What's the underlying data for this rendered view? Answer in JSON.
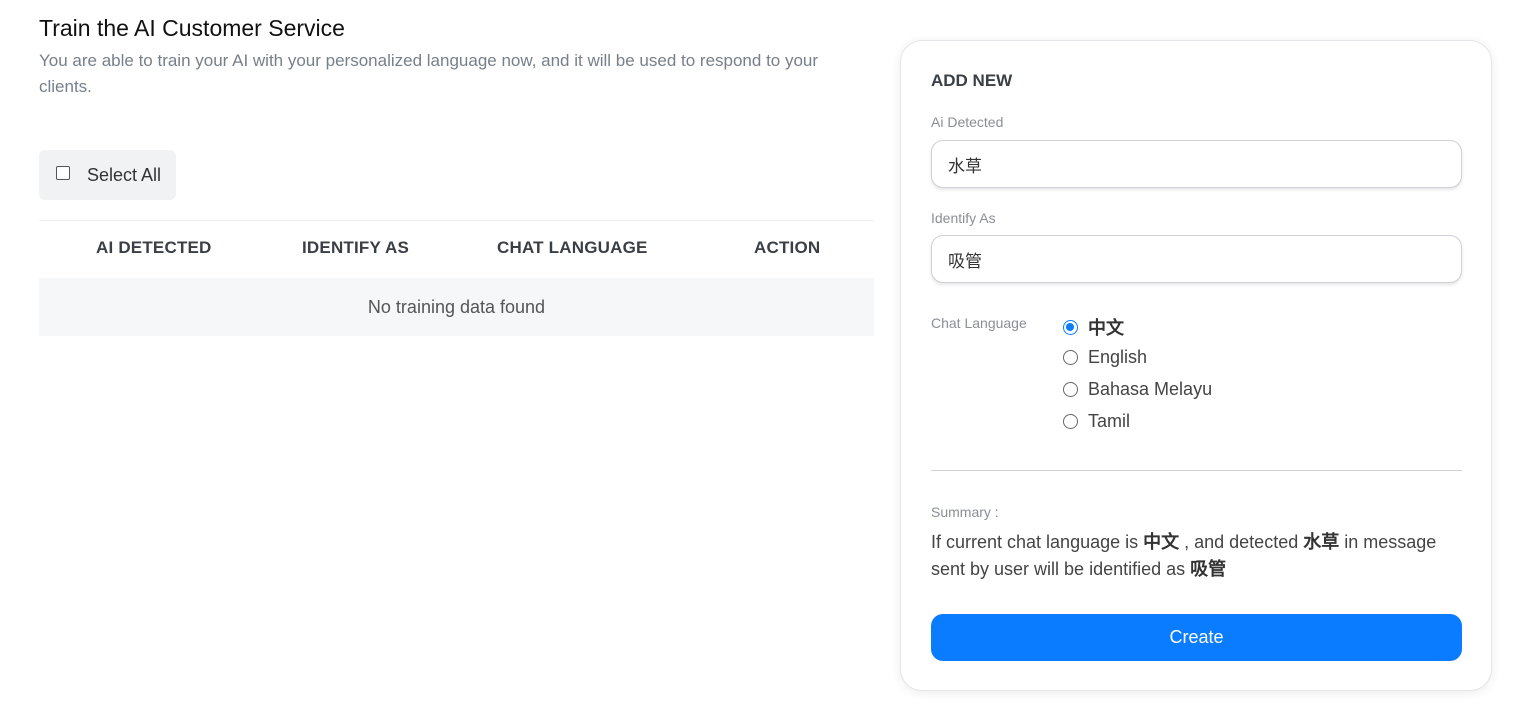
{
  "header": {
    "title": "Train the AI Customer Service",
    "subtitle": "You are able to train your AI with your personalized language now, and it will be used to respond to your clients."
  },
  "table": {
    "select_all_label": "Select All",
    "columns": [
      "AI DETECTED",
      "IDENTIFY AS",
      "CHAT LANGUAGE",
      "ACTION"
    ],
    "empty_message": "No training data found"
  },
  "form": {
    "title": "ADD NEW",
    "ai_detected_label": "Ai Detected",
    "ai_detected_value": "水草",
    "identify_as_label": "Identify As",
    "identify_as_value": "吸管",
    "chat_language_label": "Chat Language",
    "languages": [
      {
        "label": "中文",
        "checked": true
      },
      {
        "label": "English",
        "checked": false
      },
      {
        "label": "Bahasa Melayu",
        "checked": false
      },
      {
        "label": "Tamil",
        "checked": false
      }
    ],
    "summary_label": "Summary :",
    "summary": {
      "part1": "If current chat language is ",
      "language": "中文",
      "part2": " , and detected ",
      "detected": "水草",
      "part3": " in message sent by user will be identified as ",
      "identified": "吸管"
    },
    "create_label": "Create"
  },
  "colors": {
    "accent": "#0a7cff",
    "muted_text": "#777f8a"
  }
}
